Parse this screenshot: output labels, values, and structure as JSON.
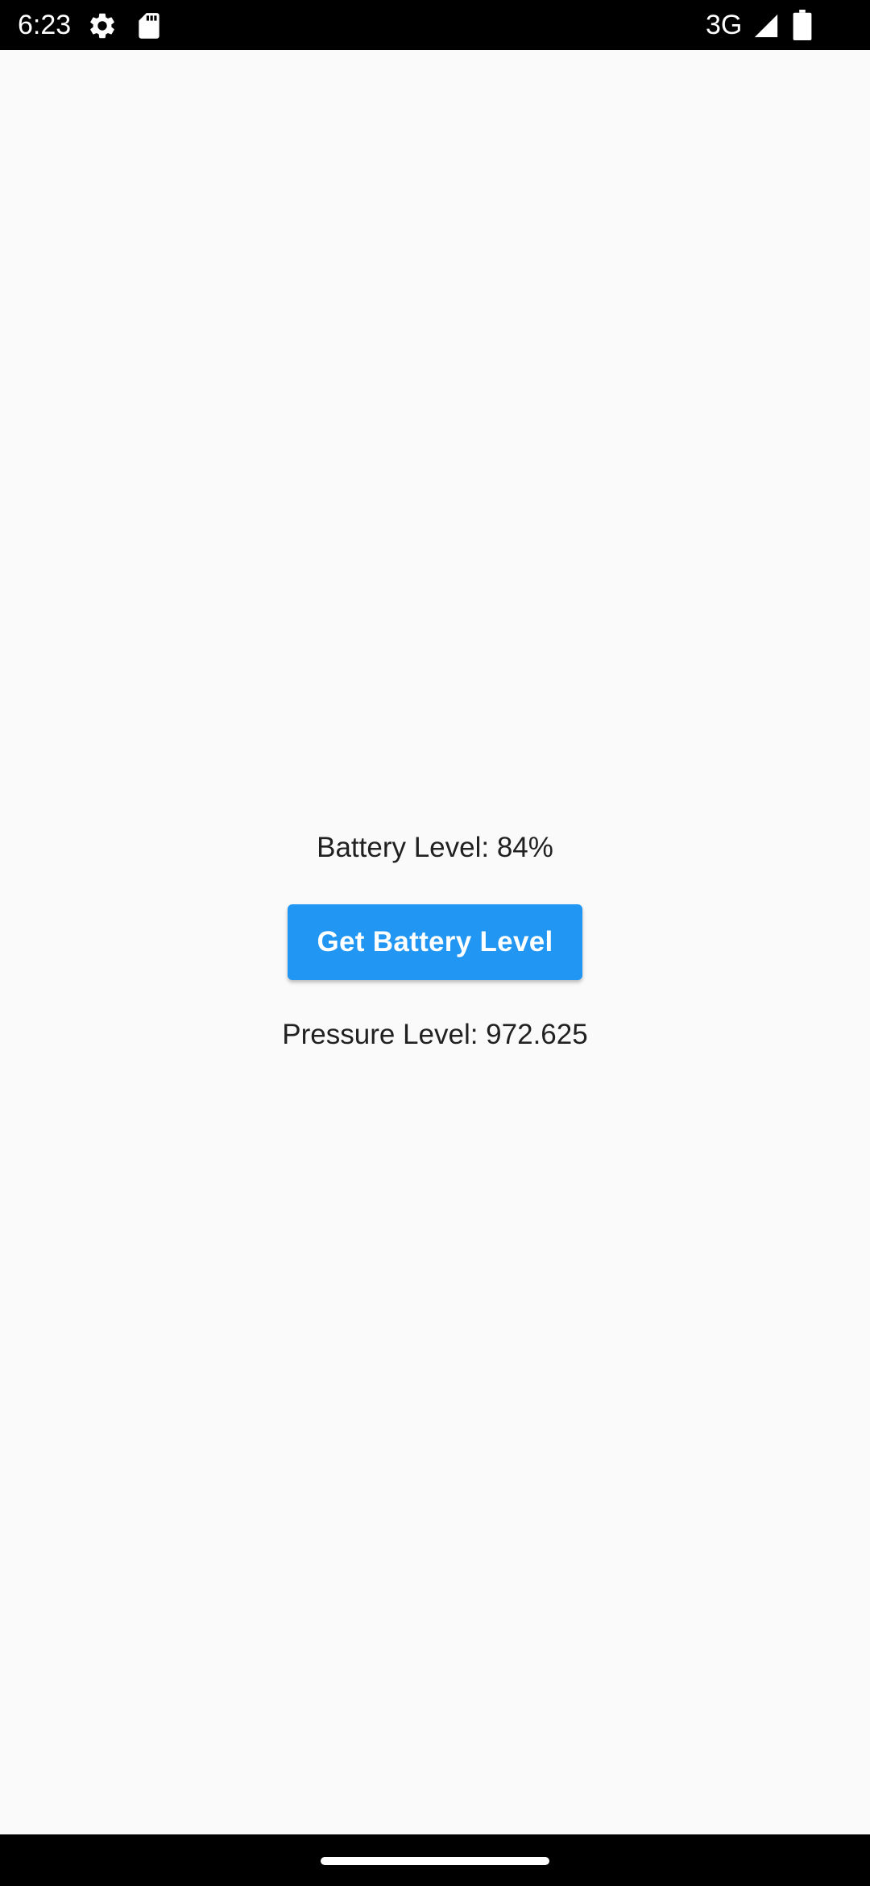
{
  "status_bar": {
    "time": "6:23",
    "network": "3G",
    "icons": [
      "gear-icon",
      "sd-card-icon",
      "signal-icon",
      "battery-icon"
    ]
  },
  "main": {
    "battery_text": "Battery Level: 84%",
    "button_label": "Get Battery Level",
    "pressure_text": "Pressure Level: 972.625"
  },
  "colors": {
    "accent": "#2196f3",
    "background": "#fafafa",
    "text": "#212121",
    "system_bars": "#000000"
  }
}
